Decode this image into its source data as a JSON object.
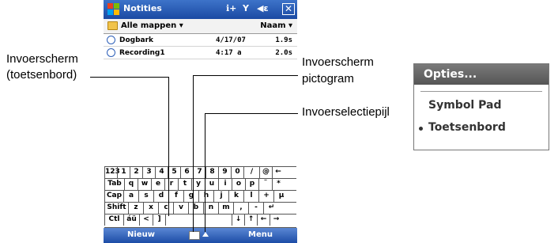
{
  "phone": {
    "title": "Notities",
    "status_icons": {
      "connectivity": "ℹ+",
      "signal": "Y",
      "volume": "◀ε",
      "close": "✕"
    },
    "toolbar": {
      "folder": "Alle mappen ▾",
      "sort": "Naam ▾"
    },
    "files": [
      {
        "name": "Dogbark",
        "date": "4/17/07",
        "size": "1.9s"
      },
      {
        "name": "Recording1",
        "date": "4:17 a",
        "size": "2.0s"
      }
    ],
    "keyboard": [
      [
        "123",
        "1",
        "2",
        "3",
        "4",
        "5",
        "6",
        "7",
        "8",
        "9",
        "0",
        "/",
        "@",
        "←"
      ],
      [
        "Tab",
        "q",
        "w",
        "e",
        "r",
        "t",
        "y",
        "u",
        "i",
        "o",
        "p",
        "¨",
        "*"
      ],
      [
        "Cap",
        "a",
        "s",
        "d",
        "f",
        "g",
        "h",
        "j",
        "k",
        "l",
        "+",
        "µ"
      ],
      [
        "Shift",
        "z",
        "x",
        "c",
        "v",
        "b",
        "n",
        "m",
        ",",
        "-",
        "↵"
      ],
      [
        "Ctl",
        "áü",
        "<",
        "]",
        "",
        "↓",
        "↑",
        "←",
        "→"
      ]
    ],
    "softkeys": {
      "left": "Nieuw",
      "right": "Menu"
    }
  },
  "callouts": {
    "input_panel_line1": "Invoerscherm",
    "input_panel_line2": "(toetsenbord)",
    "input_icon_line1": "Invoerscherm",
    "input_icon_line2": "pictogram",
    "selector_arrow": "Invoerselectiepijl"
  },
  "options_menu": {
    "header": "Opties...",
    "items": [
      "Symbol Pad",
      "Toetsenbord"
    ],
    "selected": "Toetsenbord"
  },
  "colors": {
    "title_bar": "#2b5fbb",
    "softkey_bar": "#2a5ab5",
    "options_header": "#666666"
  }
}
